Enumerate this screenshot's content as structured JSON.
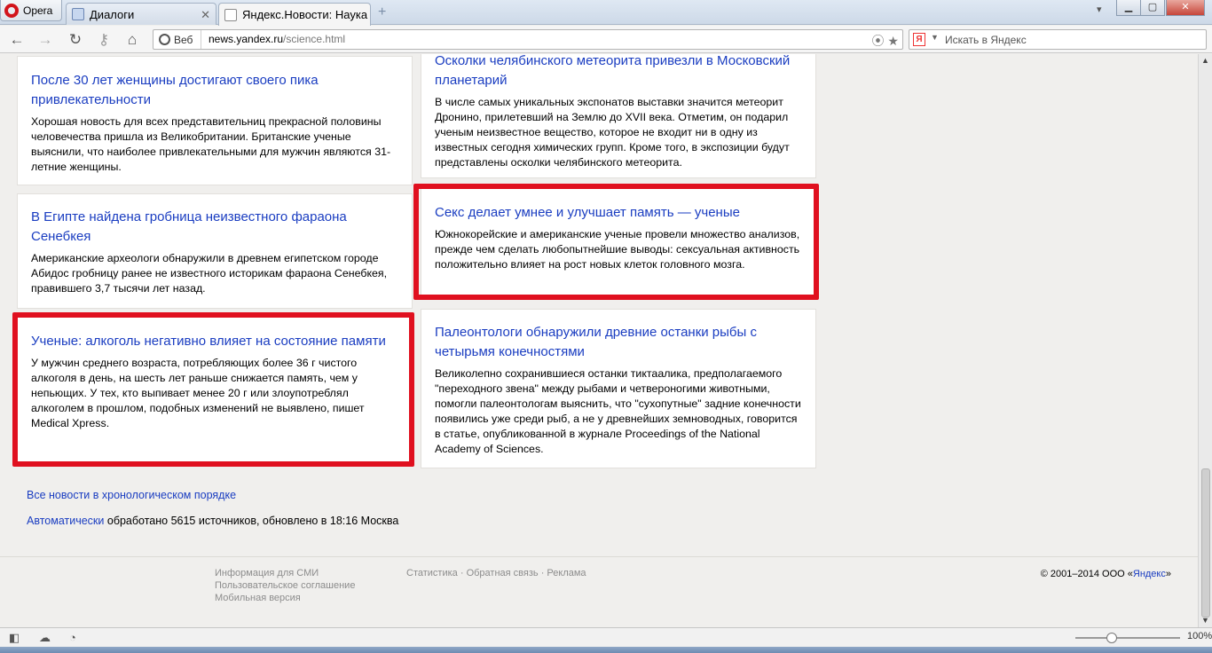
{
  "browser": {
    "opera_label": "Opera",
    "tabs": [
      {
        "label": "Диалоги"
      },
      {
        "label": "Яндекс.Новости: Наука"
      }
    ],
    "address": {
      "web_label": "Веб",
      "domain": "news.yandex.ru",
      "path": "/science.html"
    },
    "search": {
      "logo": "Я",
      "placeholder": "Искать в Яндекс"
    },
    "status": {
      "zoom": "100%"
    }
  },
  "news": [
    {
      "title": "После 30 лет женщины достигают своего пика привлекательности",
      "text": "Хорошая новость для всех представительниц прекрасной половины человечества пришла из Великобритании. Британские ученые выяснили, что наиболее привлекательными для мужчин являются 31-летние женщины."
    },
    {
      "title": "Осколки челябинского метеорита привезли в Московский планетарий",
      "text": "В числе самых уникальных экспонатов выставки значится метеорит Дронино, прилетевший на Землю до XVII века. Отметим, он подарил ученым неизвестное вещество, которое не входит ни в одну из известных сегодня химических групп. Кроме того, в экспозиции будут представлены осколки челябинского метеорита."
    },
    {
      "title": "В Египте найдена гробница неизвестного фараона Сенебкея",
      "text": "Американские археологи обнаружили в древнем египетском городе Абидос гробницу ранее не известного историкам фараона Сенебкея, правившего 3,7 тысячи лет назад."
    },
    {
      "title": "Секс делает умнее и улучшает память — ученые",
      "text": "Южнокорейские и американские ученые провели множество анализов, прежде чем сделать любопытнейшие выводы: сексуальная активность положительно влияет на рост новых клеток головного мозга."
    },
    {
      "title": "Ученые: алкоголь негативно влияет на состояние памяти",
      "text": "У мужчин среднего возраста, потребляющих более 36 г чистого алкоголя в день, на шесть лет раньше снижается память, чем у непьющих. У тех, кто выпивает менее 20 г или злоупотреблял алкоголем в прошлом, подобных изменений не выявлено, пишет Medical Xpress."
    },
    {
      "title": "Палеонтологи обнаружили древние останки рыбы с четырьмя конечностями",
      "text": "Великолепно сохранившиеся останки тиктаалика, предполагаемого \"переходного звена\" между рыбами и четвероногими животными, помогли палеонтологам выяснить, что \"сухопутные\" задние конечности появились уже среди рыб, а не у древнейших земноводных, говорится в статье, опубликованной в журнале Proceedings of the National Academy of Sciences."
    }
  ],
  "page_footer": {
    "all_news_link": "Все новости в хронологическом порядке",
    "auto_link": "Автоматически",
    "auto_text": " обработано 5615 источников, обновлено в 18:16 Москва",
    "links_col1": [
      "Информация для СМИ",
      "Пользовательское соглашение",
      "Мобильная версия"
    ],
    "links_col2": [
      "Статистика",
      "Обратная связь",
      "Реклама"
    ],
    "copyright_prefix": "© 2001–2014  ООО «",
    "copyright_link": "Яндекс",
    "copyright_suffix": "»"
  },
  "colors": {
    "link": "#1a3dc1",
    "highlight": "#e0101f"
  }
}
